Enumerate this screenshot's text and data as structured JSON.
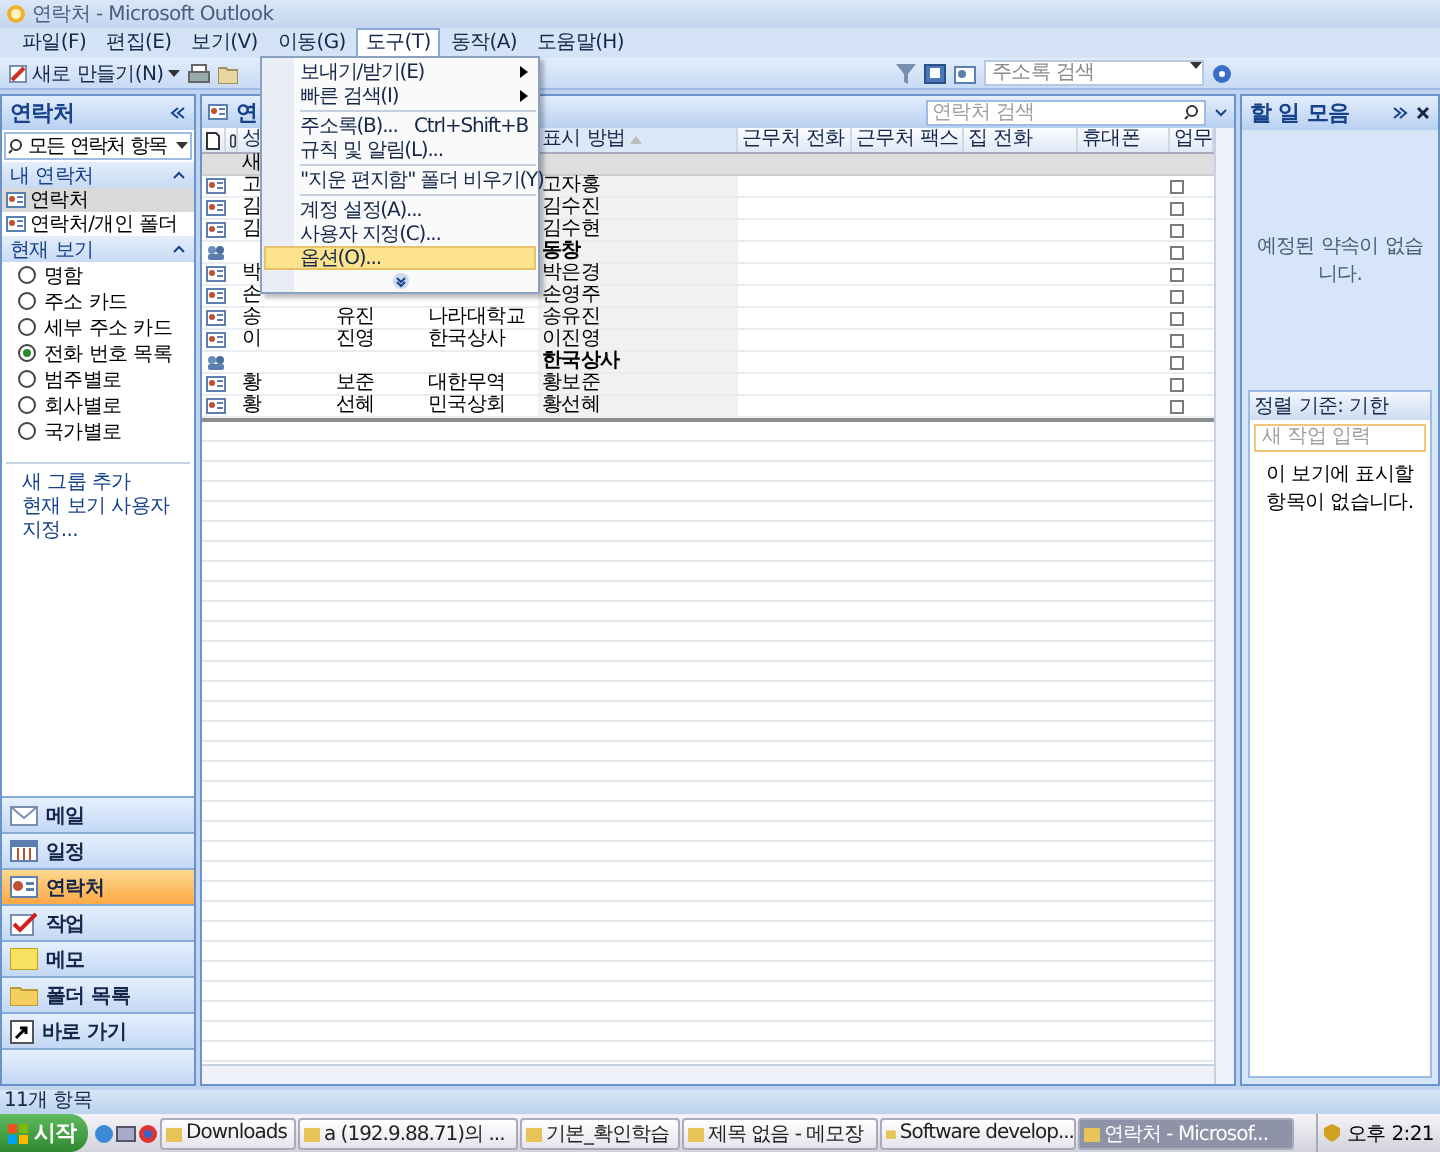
{
  "window": {
    "title": "연락처 - Microsoft Outlook"
  },
  "menu_bar": [
    {
      "label": "파일(F)",
      "open": false
    },
    {
      "label": "편집(E)",
      "open": false
    },
    {
      "label": "보기(V)",
      "open": false
    },
    {
      "label": "이동(G)",
      "open": false
    },
    {
      "label": "도구(T)",
      "open": true
    },
    {
      "label": "동작(A)",
      "open": false
    },
    {
      "label": "도움말(H)",
      "open": false
    }
  ],
  "toolbar": {
    "new_button": "새로 만들기(N)",
    "search": {
      "placeholder": "주소록 검색"
    }
  },
  "tools_menu": {
    "items": [
      {
        "kind": "submenu",
        "label": "보내기/받기(E)",
        "selected": false
      },
      {
        "kind": "submenu",
        "label": "빠른 검색(I)",
        "selected": false
      },
      {
        "kind": "separator"
      },
      {
        "kind": "command",
        "label": "주소록(B)...",
        "shortcut": "Ctrl+Shift+B",
        "selected": false
      },
      {
        "kind": "command",
        "label": "규칙 및 알림(L)...",
        "selected": false
      },
      {
        "kind": "separator"
      },
      {
        "kind": "command",
        "label": "\"지운 편지함\" 폴더 비우기(Y)",
        "selected": false
      },
      {
        "kind": "separator"
      },
      {
        "kind": "command",
        "label": "계정 설정(A)...",
        "selected": false
      },
      {
        "kind": "command",
        "label": "사용자 지정(C)...",
        "selected": false
      },
      {
        "kind": "command",
        "label": "옵션(O)...",
        "selected": true
      },
      {
        "kind": "more"
      }
    ]
  },
  "nav_pane": {
    "title": "연락처",
    "folder_filter": "모든 연락처 항목",
    "sections": [
      {
        "kind": "folders",
        "title": "내 연락처",
        "expanded": true,
        "items": [
          {
            "label": "연락처",
            "selected": true
          },
          {
            "label": "연락처/개인 폴더",
            "selected": false
          }
        ]
      },
      {
        "kind": "views",
        "title": "현재 보기",
        "expanded": true,
        "items": [
          {
            "label": "명함",
            "selected": false
          },
          {
            "label": "주소 카드",
            "selected": false
          },
          {
            "label": "세부 주소 카드",
            "selected": false
          },
          {
            "label": "전화 번호 목록",
            "selected": true
          },
          {
            "label": "범주별로",
            "selected": false
          },
          {
            "label": "회사별로",
            "selected": false
          },
          {
            "label": "국가별로",
            "selected": false
          }
        ]
      }
    ],
    "links": [
      "새 그룹 추가",
      "현재 보기 사용자 지정..."
    ],
    "buttons": [
      {
        "label": "메일",
        "selected": false
      },
      {
        "label": "일정",
        "selected": false
      },
      {
        "label": "연락처",
        "selected": true
      },
      {
        "label": "작업",
        "selected": false
      },
      {
        "label": "메모",
        "selected": false
      },
      {
        "label": "폴더 목록",
        "selected": false
      },
      {
        "label": "바로 가기",
        "selected": false
      }
    ]
  },
  "contacts": {
    "title": "연",
    "search": {
      "placeholder": "연락처 검색"
    },
    "columns": {
      "surname": {
        "label": "성",
        "sorted": false
      },
      "display_as": {
        "label": "표시 방법",
        "sorted": true,
        "ascending": true
      },
      "business_phone": {
        "label": "근무처 전화",
        "sorted": false
      },
      "business_fax": {
        "label": "근무처 팩스",
        "sorted": false
      },
      "home_phone": {
        "label": "집 전화",
        "sorted": false
      },
      "mobile_phone": {
        "label": "휴대폰",
        "sorted": false
      },
      "task": {
        "label": "업무",
        "sorted": false
      }
    },
    "new_row": "새",
    "rows": [
      {
        "kind": "contact",
        "surname": "고",
        "display_as": "고자홍",
        "checked": false
      },
      {
        "kind": "contact",
        "surname": "김",
        "display_as": "김수진",
        "checked": false
      },
      {
        "kind": "contact",
        "surname": "김",
        "display_as": "김수현",
        "checked": false
      },
      {
        "kind": "group",
        "display_as": "동창",
        "checked": false
      },
      {
        "kind": "contact",
        "surname": "박",
        "display_as": "박은경",
        "checked": false
      },
      {
        "kind": "contact",
        "surname": "손",
        "display_as": "손영주",
        "checked": false
      },
      {
        "kind": "contact",
        "surname": "송",
        "given": "유진",
        "company": "나라대학교",
        "display_as": "송유진",
        "checked": false
      },
      {
        "kind": "contact",
        "surname": "이",
        "given": "진영",
        "company": "한국상사",
        "display_as": "이진영",
        "checked": false
      },
      {
        "kind": "group",
        "display_as": "한국상사",
        "checked": false
      },
      {
        "kind": "contact",
        "surname": "황",
        "given": "보준",
        "company": "대한무역",
        "display_as": "황보준",
        "checked": false
      },
      {
        "kind": "contact",
        "surname": "황",
        "given": "선혜",
        "company": "민국상회",
        "display_as": "황선혜",
        "checked": false
      }
    ]
  },
  "todo_bar": {
    "title": "할 일 모음",
    "appointments_empty": "예정된 약속이 없습니다.",
    "tasks": {
      "arrange_by": "정렬 기준: 기한",
      "new_task_placeholder": "새 작업 입력",
      "empty": "이 보기에 표시할 항목이 없습니다."
    }
  },
  "status_bar": {
    "text": "11개 항목"
  },
  "taskbar": {
    "start": "시작",
    "buttons": [
      {
        "label": "Downloads",
        "selected": false
      },
      {
        "label": "a (192.9.88.71)의 ...",
        "selected": false
      },
      {
        "label": "기본_확인학습",
        "selected": false
      },
      {
        "label": "제목 없음 - 메모장",
        "selected": false
      },
      {
        "label": "Software develop...",
        "selected": false
      },
      {
        "label": "연락처 - Microsof...",
        "selected": true
      }
    ],
    "clock": "오후 2:21"
  }
}
